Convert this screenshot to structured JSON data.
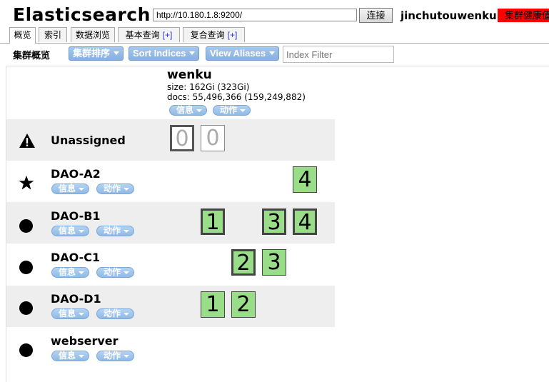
{
  "header": {
    "title": "Elasticsearch",
    "url": "http://10.180.1.8:9200/",
    "connect_label": "连接",
    "cluster_name": "jinchutouwenku",
    "health_label": "集群健康值"
  },
  "tabs": [
    {
      "label": "概览",
      "plus": ""
    },
    {
      "label": "索引",
      "plus": ""
    },
    {
      "label": "数据浏览",
      "plus": ""
    },
    {
      "label": "基本查询",
      "plus": "[+]"
    },
    {
      "label": "复合查询",
      "plus": "[+]"
    }
  ],
  "toolbar": {
    "label": "集群概览",
    "sort_cluster": "集群排序",
    "sort_indices": "Sort Indices",
    "view_aliases": "View Aliases",
    "filter_placeholder": "Index Filter"
  },
  "index": {
    "name": "wenku",
    "size": "size: 162Gi (323Gi)",
    "docs": "docs: 55,496,366 (159,249,882)",
    "info_label": "信息",
    "action_label": "动作"
  },
  "unassigned": {
    "label": "Unassigned",
    "shards": [
      "0",
      "0"
    ]
  },
  "nodes": [
    {
      "name": "DAO-A2",
      "info_label": "信息",
      "action_label": "动作",
      "icon": "star-icon",
      "shards": [
        "4"
      ]
    },
    {
      "name": "DAO-B1",
      "info_label": "信息",
      "action_label": "动作",
      "icon": "dot-icon",
      "shards": [
        "1",
        "3",
        "4"
      ]
    },
    {
      "name": "DAO-C1",
      "info_label": "信息",
      "action_label": "动作",
      "icon": "dot-icon",
      "shards": [
        "2",
        "3"
      ]
    },
    {
      "name": "DAO-D1",
      "info_label": "信息",
      "action_label": "动作",
      "icon": "dot-icon",
      "shards": [
        "1",
        "2"
      ]
    },
    {
      "name": "webserver",
      "info_label": "信息",
      "action_label": "动作",
      "icon": "dot-icon",
      "shards": []
    }
  ],
  "colors": {
    "shard_green": "#99dd88",
    "health_red": "#ff0000",
    "button_blue": "#86b0df",
    "row_alt": "#eeeeee"
  }
}
